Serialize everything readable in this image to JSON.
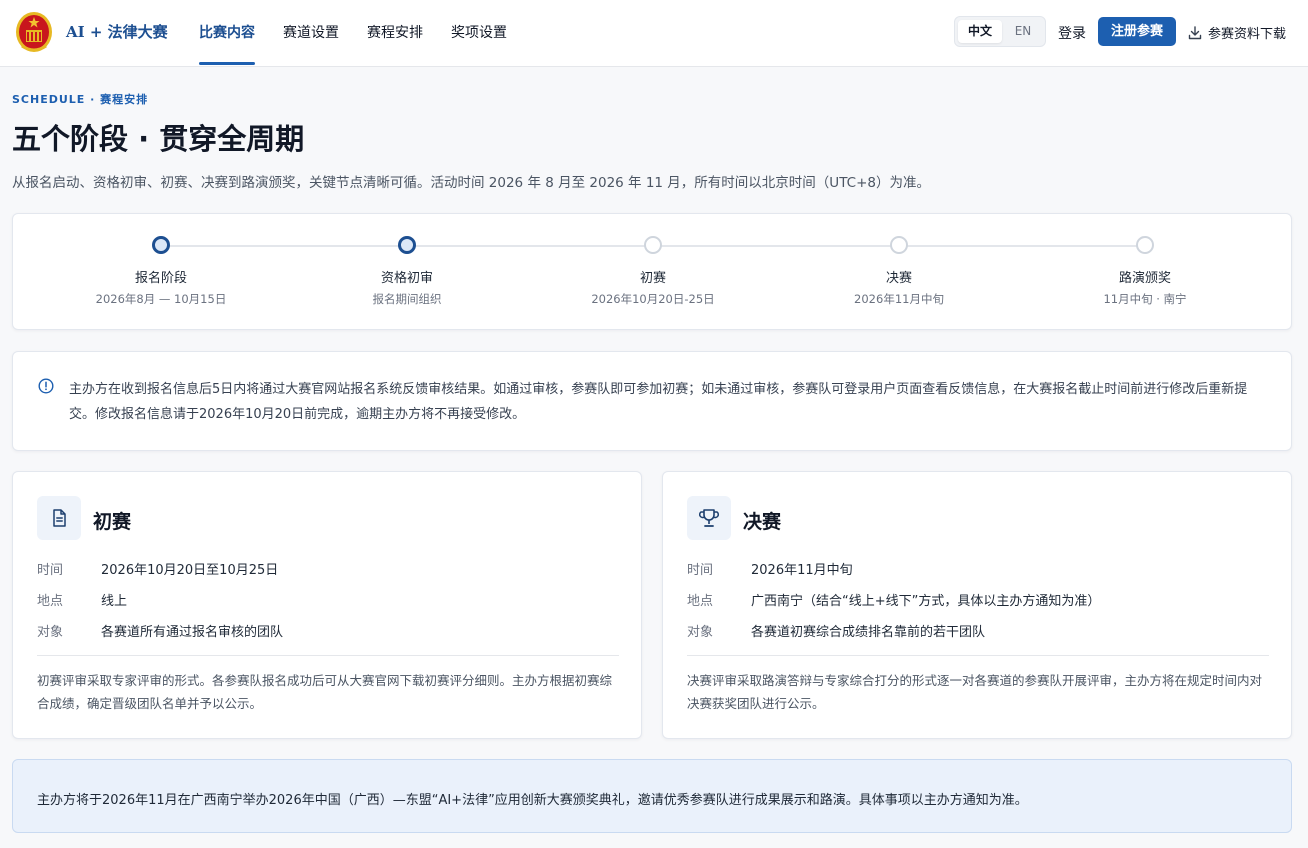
{
  "header": {
    "brand": "AI + 法律大赛",
    "nav": [
      "比赛内容",
      "赛道设置",
      "赛程安排",
      "奖项设置"
    ],
    "lang_zh": "中文",
    "lang_en": "EN",
    "login": "登录",
    "register": "注册参赛",
    "download": "参赛资料下载"
  },
  "intro": {
    "eyebrow": "SCHEDULE · 赛程安排",
    "title": "五个阶段 · 贯穿全周期",
    "subtitle": "从报名启动、资格初审、初赛、决赛到路演颁奖，关键节点清晰可循。活动时间 2026 年 8 月至 2026 年 11 月，所有时间以北京时间（UTC+8）为准。"
  },
  "timeline": [
    {
      "label": "报名阶段",
      "date": "2026年8月 — 10月15日",
      "active": true
    },
    {
      "label": "资格初审",
      "date": "报名期间组织",
      "active": true
    },
    {
      "label": "初赛",
      "date": "2026年10月20日-25日",
      "active": false
    },
    {
      "label": "决赛",
      "date": "2026年11月中旬",
      "active": false
    },
    {
      "label": "路演颁奖",
      "date": "11月中旬 · 南宁",
      "active": false
    }
  ],
  "notice": {
    "icon": "info-icon",
    "text": "主办方在收到报名信息后5日内将通过大赛官网站报名系统反馈审核结果。如通过审核，参赛队即可参加初赛；如未通过审核，参赛队可登录用户页面查看反馈信息，在大赛报名截止时间前进行修改后重新提交。修改报名信息请于2026年10月20日前完成，逾期主办方将不再接受修改。"
  },
  "stages": {
    "prelim": {
      "icon": "document-icon",
      "title": "初赛",
      "time_label": "时间",
      "time": "2026年10月20日至10月25日",
      "place_label": "地点",
      "place": "线上",
      "target_label": "对象",
      "target": "各赛道所有通过报名审核的团队",
      "note": "初赛评审采取专家评审的形式。各参赛队报名成功后可从大赛官网下载初赛评分细则。主办方根据初赛综合成绩，确定晋级团队名单并予以公示。"
    },
    "final": {
      "icon": "trophy-icon",
      "title": "决赛",
      "time_label": "时间",
      "time": "2026年11月中旬",
      "place_label": "地点",
      "place": "广西南宁（结合“线上+线下”方式，具体以主办方通知为准）",
      "target_label": "对象",
      "target": "各赛道初赛综合成绩排名靠前的若干团队",
      "note": "决赛评审采取路演答辩与专家综合打分的形式逐一对各赛道的参赛队开展评审，主办方将在规定时间内对决赛获奖团队进行公示。"
    }
  },
  "banner": {
    "text": "主办方将于2026年11月在广西南宁举办2026年中国（广西）—东盟“AI+法律”应用创新大赛颁奖典礼，邀请优秀参赛队进行成果展示和路演。具体事项以主办方通知为准。"
  },
  "colors": {
    "accent": "#1d5fb0",
    "brand": "#1d4f91",
    "emblem_red": "#c8161d",
    "emblem_gold": "#f2c230"
  }
}
